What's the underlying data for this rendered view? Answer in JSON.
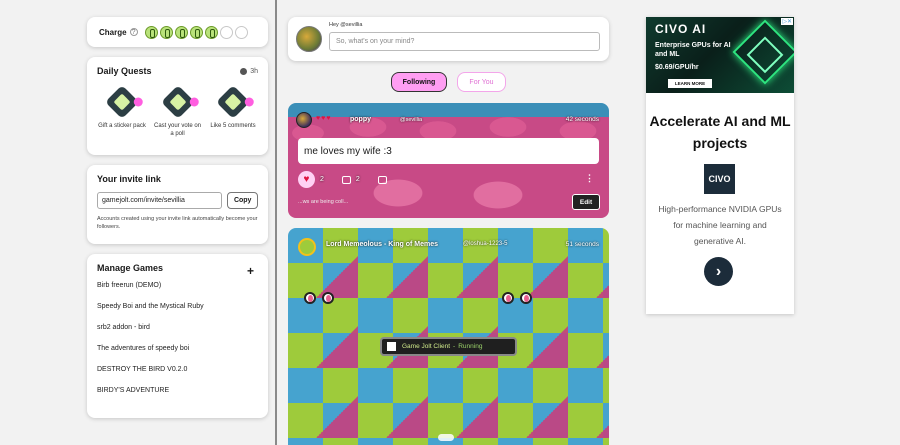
{
  "charge": {
    "label": "Charge",
    "help": "?",
    "orbs_filled": 5,
    "orbs_total": 7
  },
  "quests": {
    "title": "Daily Quests",
    "timer": "3h",
    "items": [
      {
        "label": "Gift a sticker pack"
      },
      {
        "label": "Cast your vote on a poll"
      },
      {
        "label": "Like 5 comments"
      }
    ]
  },
  "invite": {
    "title": "Your invite link",
    "link": "gamejolt.com/invite/sevillia",
    "copy_label": "Copy",
    "note": "Accounts created using your invite link automatically become your followers."
  },
  "games": {
    "title": "Manage Games",
    "add": "+",
    "items": [
      "Birb freerun (DEMO)",
      "Speedy Boi and the Mystical Ruby",
      "srb2 addon - bird",
      "The adventures of speedy boi",
      "DESTROY THE BIRD V0.2.0",
      "BIRDY'S ADVENTURE"
    ]
  },
  "composer": {
    "greeting": "Hey @sevillia",
    "placeholder": "So, what's on your mind?"
  },
  "feed_tabs": {
    "following": "Following",
    "for_you": "For You"
  },
  "post1": {
    "hearts": "♥♥♥",
    "name": "poppy",
    "handle": "@sevillia",
    "time": "42 seconds",
    "body": "me loves my wife :3",
    "likes": "2",
    "comments": "2",
    "more": "⋮",
    "caption": "...ws are being coll...",
    "edit_label": "Edit"
  },
  "post2": {
    "name": "Lord Memeolous - King of Memes",
    "handle": "@loshua-1223-5",
    "time": "51 seconds",
    "client_label": "Game Jolt Client",
    "client_sep": "-",
    "client_status": "Running"
  },
  "ad": {
    "brand": "CIVO AI",
    "headline": "Enterprise GPUs for AI and ML",
    "price": "$0.69/GPU/hr",
    "learn": "LEARN MORE",
    "adchoice": "▷✕",
    "title": "Accelerate AI and ML projects",
    "logo": "CIVO",
    "desc": "High-performance NVIDIA GPUs for machine learning and generative AI.",
    "arrow": "›"
  }
}
